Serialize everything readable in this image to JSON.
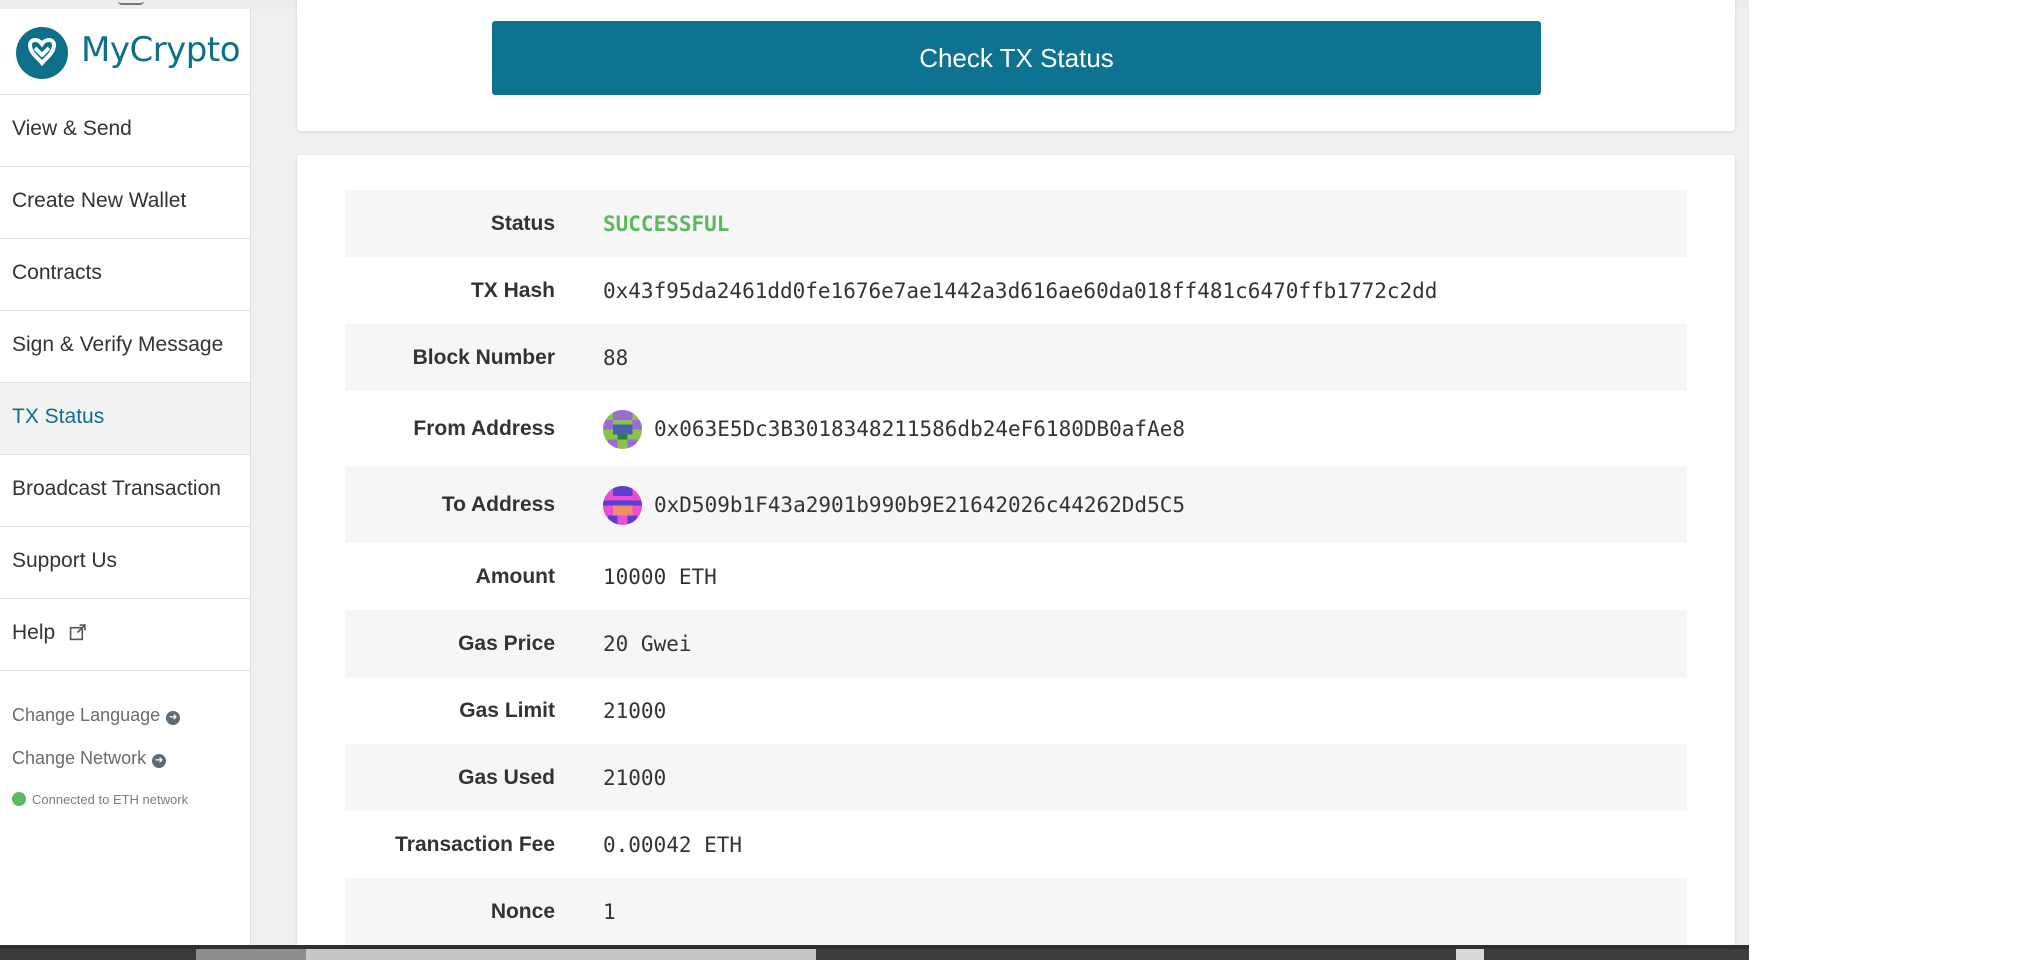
{
  "brand": {
    "name": "MyCrypto",
    "icon": "mycrypto-logo-icon",
    "color": "#0d6f89"
  },
  "sidebar": {
    "items": [
      {
        "label": "View & Send"
      },
      {
        "label": "Create New Wallet"
      },
      {
        "label": "Contracts"
      },
      {
        "label": "Sign & Verify Message"
      },
      {
        "label": "TX Status",
        "active": true
      },
      {
        "label": "Broadcast Transaction"
      },
      {
        "label": "Support Us"
      },
      {
        "label": "Help",
        "icon": "external-link-icon"
      }
    ],
    "change_language": "Change Language",
    "change_network": "Change Network",
    "connection_status": "Connected to ETH network",
    "connection_color": "#5dbb63"
  },
  "check_button": {
    "label": "Check TX Status",
    "color": "#0d7391"
  },
  "tx": {
    "status_label": "Status",
    "status": "SUCCESSFUL",
    "status_color": "#5cb85c",
    "hash_label": "TX Hash",
    "hash": "0x43f95da2461dd0fe1676e7ae1442a3d616ae60da018ff481c6470ffb1772c2dd",
    "block_label": "Block Number",
    "block": "88",
    "from_label": "From Address",
    "from": "0x063E5Dc3B3018348211586db24eF6180DB0afAe8",
    "to_label": "To Address",
    "to": "0xD509b1F43a2901b990b9E21642026c44262Dd5C5",
    "amount_label": "Amount",
    "amount": "10000 ETH",
    "gas_price_label": "Gas Price",
    "gas_price": "20 Gwei",
    "gas_limit_label": "Gas Limit",
    "gas_limit": "21000",
    "gas_used_label": "Gas Used",
    "gas_used": "21000",
    "fee_label": "Transaction Fee",
    "fee": "0.00042 ETH",
    "nonce_label": "Nonce",
    "nonce": "1"
  }
}
